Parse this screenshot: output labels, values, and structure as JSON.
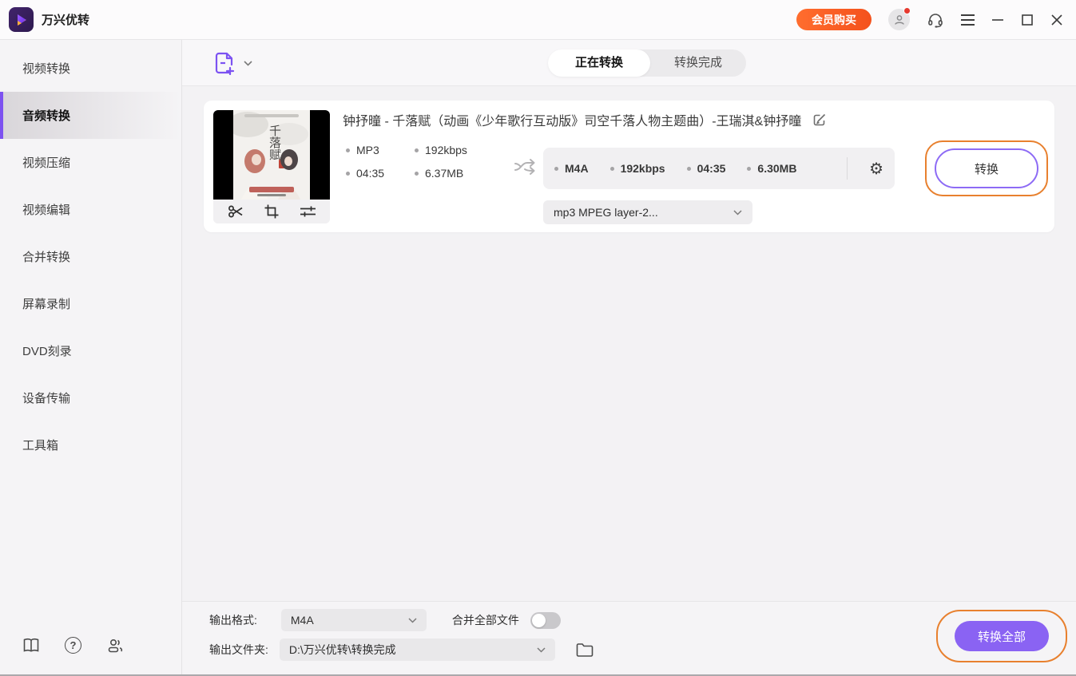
{
  "app": {
    "title": "万兴优转"
  },
  "titlebar": {
    "member_button": "会员购买",
    "icons": [
      "user-avatar",
      "headset",
      "menu",
      "minimize",
      "maximize",
      "close"
    ]
  },
  "sidebar": {
    "items": [
      {
        "label": "视频转换",
        "active": false
      },
      {
        "label": "音频转换",
        "active": true
      },
      {
        "label": "视频压缩",
        "active": false
      },
      {
        "label": "视频编辑",
        "active": false
      },
      {
        "label": "合并转换",
        "active": false
      },
      {
        "label": "屏幕录制",
        "active": false
      },
      {
        "label": "DVD刻录",
        "active": false
      },
      {
        "label": "设备传输",
        "active": false
      },
      {
        "label": "工具箱",
        "active": false
      }
    ],
    "bottom_icons": [
      "user-guide-book",
      "help-question",
      "community-people"
    ],
    "help_glyph": "?"
  },
  "tabs": {
    "converting": "正在转换",
    "finished": "转换完成"
  },
  "file": {
    "title": "钟抒曈 - 千落赋（动画《少年歌行互动版》司空千落人物主题曲）-王瑞淇&钟抒曈",
    "album_art_text": "千落赋",
    "source": {
      "format": "MP3",
      "bitrate": "192kbps",
      "duration": "04:35",
      "size": "6.37MB"
    },
    "target": {
      "format": "M4A",
      "bitrate": "192kbps",
      "duration": "04:35",
      "size": "6.30MB"
    },
    "codec_dropdown": "mp3 MPEG layer-2...",
    "convert_button": "转换",
    "gear_glyph": "⚙"
  },
  "footer": {
    "output_format_label": "输出格式:",
    "output_format_value": "M4A",
    "merge_label": "合并全部文件",
    "merge_toggle_on": false,
    "output_folder_label": "输出文件夹:",
    "output_folder_value": "D:\\万兴优转\\转换完成",
    "convert_all_button": "转换全部"
  },
  "colors": {
    "accent_purple": "#7d52f0",
    "button_purple": "#8a63f3",
    "accent_orange": "#f4511c",
    "annotation_orange": "#e8802e",
    "badge_red": "#e6392e"
  }
}
